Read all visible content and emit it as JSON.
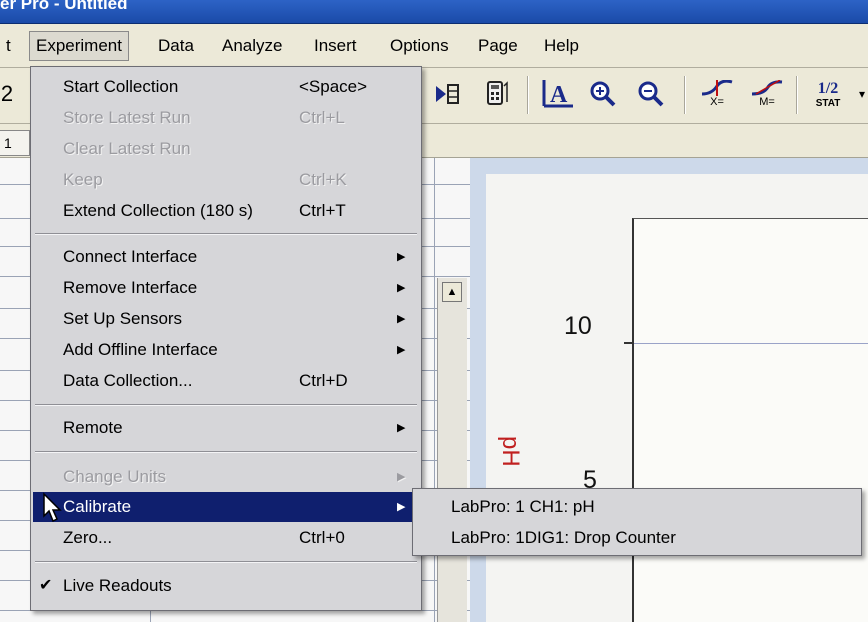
{
  "window": {
    "title": "er Pro - Untitled"
  },
  "menubar": {
    "items": [
      {
        "label": "t"
      },
      {
        "label": "Experiment"
      },
      {
        "label": "Data"
      },
      {
        "label": "Analyze"
      },
      {
        "label": "Insert"
      },
      {
        "label": "Options"
      },
      {
        "label": "Page"
      },
      {
        "label": "Help"
      }
    ]
  },
  "toolbar": {
    "icons": [
      "collect-step-icon",
      "calculator-icon",
      "autoscale-icon",
      "zoom-in-icon",
      "zoom-out-icon",
      "examine-icon",
      "tangent-icon",
      "statistics-icon"
    ],
    "examine_label": "X=",
    "tangent_label": "M=",
    "stat_label": "STAT",
    "stat_symbol": "1/2"
  },
  "tabs": {
    "first": "1"
  },
  "experiment_menu": {
    "items": [
      {
        "label": "Start Collection",
        "shortcut": "<Space>"
      },
      {
        "label": "Store Latest Run",
        "shortcut": "Ctrl+L"
      },
      {
        "label": "Clear Latest Run",
        "shortcut": ""
      },
      {
        "label": "Keep",
        "shortcut": "Ctrl+K"
      },
      {
        "label": "Extend Collection (180 s)",
        "shortcut": "Ctrl+T"
      },
      {
        "label": "Connect Interface"
      },
      {
        "label": "Remove Interface"
      },
      {
        "label": "Set Up Sensors"
      },
      {
        "label": "Add Offline Interface"
      },
      {
        "label": "Data Collection...",
        "shortcut": "Ctrl+D"
      },
      {
        "label": "Remote"
      },
      {
        "label": "Change Units"
      },
      {
        "label": "Calibrate"
      },
      {
        "label": "Zero...",
        "shortcut": "Ctrl+0"
      },
      {
        "label": "Live Readouts"
      }
    ]
  },
  "calibrate_submenu": {
    "items": [
      {
        "label": "LabPro: 1 CH1: pH"
      },
      {
        "label": "LabPro: 1DIG1: Drop Counter"
      }
    ]
  },
  "graph": {
    "y_axis_label": "pH",
    "y_ticks": [
      "10",
      "5"
    ]
  },
  "colors": {
    "menu_highlight": "#0f1f6e",
    "y_label": "#c02020",
    "title_bar": "#2d63c6"
  }
}
